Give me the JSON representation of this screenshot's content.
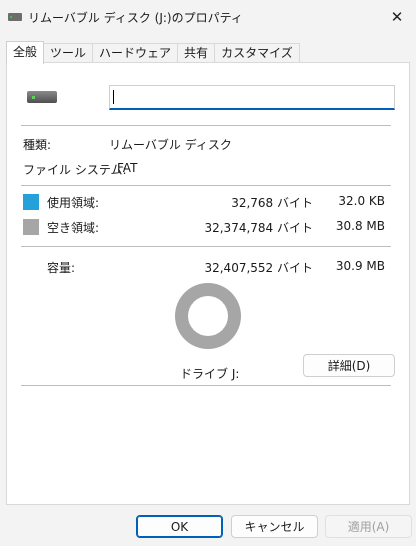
{
  "window": {
    "title": "リムーバブル ディスク (J:)のプロパティ",
    "close_glyph": "✕"
  },
  "tabs": [
    {
      "label": "全般",
      "active": true
    },
    {
      "label": "ツール",
      "active": false
    },
    {
      "label": "ハードウェア",
      "active": false
    },
    {
      "label": "共有",
      "active": false
    },
    {
      "label": "カスタマイズ",
      "active": false
    }
  ],
  "general": {
    "drive_name_value": "",
    "type_label": "種類:",
    "type_value": "リムーバブル ディスク",
    "fs_label": "ファイル システム:",
    "fs_value": "FAT",
    "used": {
      "label": "使用領域:",
      "bytes": "32,768 バイト",
      "size": "32.0 KB",
      "color": "#26a0da"
    },
    "free": {
      "label": "空き領域:",
      "bytes": "32,374,784 バイト",
      "size": "30.8 MB",
      "color": "#a6a6a6"
    },
    "capacity": {
      "label": "容量:",
      "bytes": "32,407,552 バイト",
      "size": "30.9 MB"
    },
    "used_fraction": 0.001,
    "drive_label": "ドライブ J:",
    "details_button": "詳細(D)"
  },
  "footer": {
    "ok": "OK",
    "cancel": "キャンセル",
    "apply": "適用(A)"
  }
}
